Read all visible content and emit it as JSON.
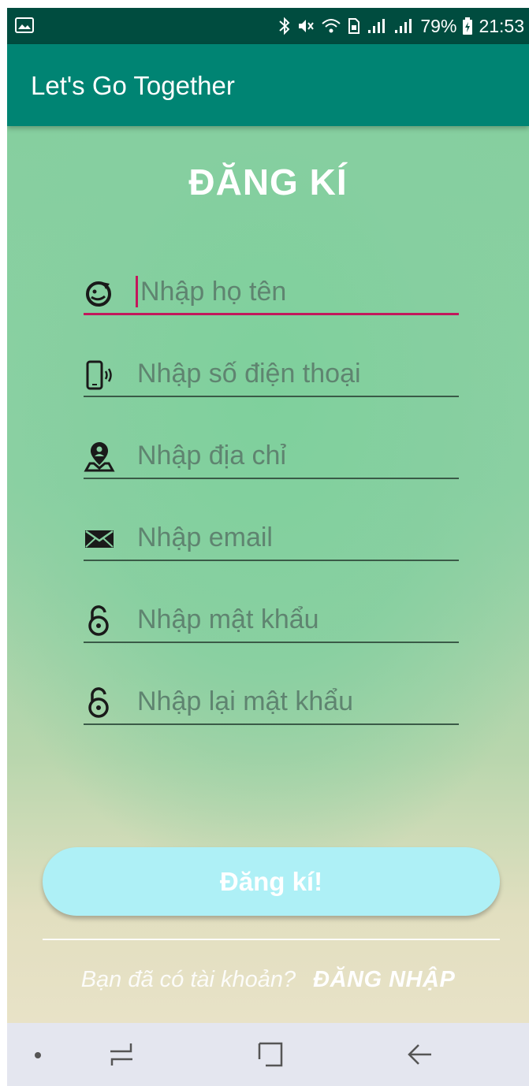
{
  "status_bar": {
    "battery": "79%",
    "time": "21:53",
    "icons": [
      "image-icon",
      "bluetooth-icon",
      "mute-icon",
      "wifi-icon",
      "sim-icon",
      "signal-icon",
      "signal-icon",
      "battery-icon"
    ]
  },
  "app_bar": {
    "title": "Let's Go Together"
  },
  "form": {
    "heading": "ĐĂNG KÍ",
    "fields": [
      {
        "icon": "face-refresh-icon",
        "placeholder": "Nhập họ tên"
      },
      {
        "icon": "phone-ringing-icon",
        "placeholder": "Nhập số điện thoại"
      },
      {
        "icon": "location-person-icon",
        "placeholder": "Nhập địa chỉ"
      },
      {
        "icon": "mail-icon",
        "placeholder": "Nhập email"
      },
      {
        "icon": "lock-open-icon",
        "placeholder": "Nhập mật khẩu"
      },
      {
        "icon": "lock-open-icon",
        "placeholder": "Nhập lại mật khẩu"
      }
    ],
    "submit_label": "Đăng kí!",
    "accent_color": "#c2185b",
    "button_color": "#aef0f6"
  },
  "footer": {
    "question": "Bạn đã có tài khoản?",
    "login_label": "ĐĂNG NHẬP"
  },
  "nav_bar": {
    "items": [
      "dot-icon",
      "recents-icon",
      "home-icon",
      "back-icon"
    ]
  }
}
